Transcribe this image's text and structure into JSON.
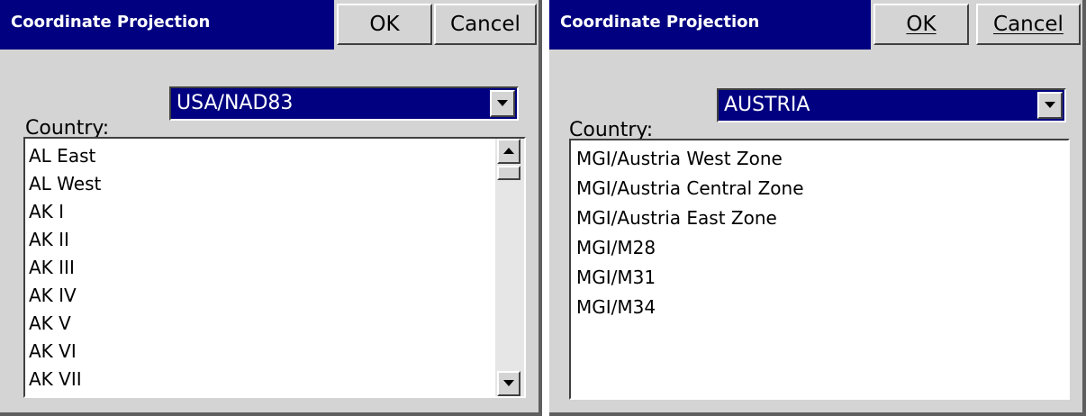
{
  "left_dialog": {
    "title": "Coordinate Projection",
    "ok_label": "OK",
    "cancel_label": "Cancel",
    "country_label": "Country:",
    "country_value": "USA/NAD83",
    "list_items": [
      "AL East",
      "AL West",
      "AK I",
      "AK II",
      "AK III",
      "AK IV",
      "AK V",
      "AK VI",
      "AK VII"
    ]
  },
  "right_dialog": {
    "title": "Coordinate Projection",
    "ok_label": "OK",
    "cancel_label": "Cancel",
    "country_label": "Country:",
    "country_value": "AUSTRIA",
    "list_items": [
      "MGI/Austria West Zone",
      "MGI/Austria Central Zone",
      "MGI/Austria East Zone",
      "MGI/M28",
      "MGI/M31",
      "MGI/M34"
    ]
  },
  "colors": {
    "title_bar": "#000080",
    "selection": "#000080",
    "dialog_face": "#d4d4d4"
  }
}
